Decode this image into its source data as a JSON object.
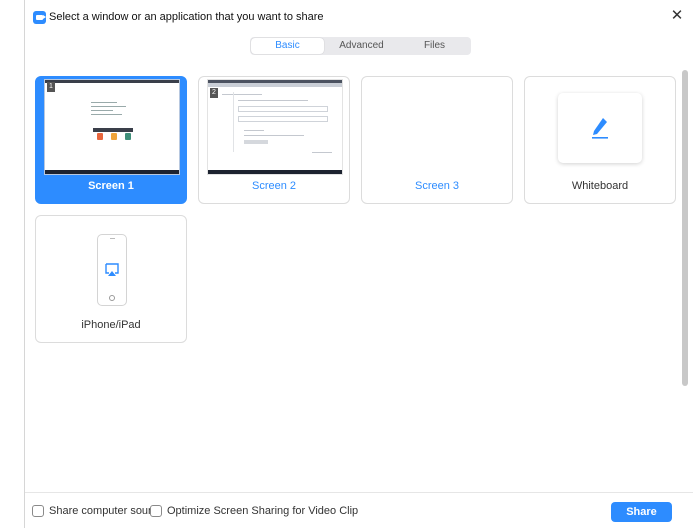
{
  "window": {
    "title": "Select a window or an application that you want to share",
    "close_glyph": "✕"
  },
  "tabs": [
    {
      "label": "Basic",
      "active": true
    },
    {
      "label": "Advanced",
      "active": false
    },
    {
      "label": "Files",
      "active": false
    }
  ],
  "tiles": [
    {
      "label": "Screen 1",
      "number": "1",
      "selected": true,
      "icon": "screen-thumbnail"
    },
    {
      "label": "Screen 2",
      "number": "2",
      "selected": false,
      "icon": "screen-thumbnail"
    },
    {
      "label": "Screen 3",
      "selected": false,
      "icon": "blank-screen"
    },
    {
      "label": "Whiteboard",
      "selected": false,
      "icon": "pencil-icon"
    },
    {
      "label": "iPhone/iPad",
      "selected": false,
      "icon": "airplay-icon"
    }
  ],
  "footer": {
    "share_sound_label": "Share computer sound",
    "optimize_label": "Optimize Screen Sharing for Video Clip",
    "share_button": "Share"
  },
  "colors": {
    "accent": "#2d8cff",
    "tab_track": "#e9e9ec",
    "border": "#dcdcdc"
  }
}
